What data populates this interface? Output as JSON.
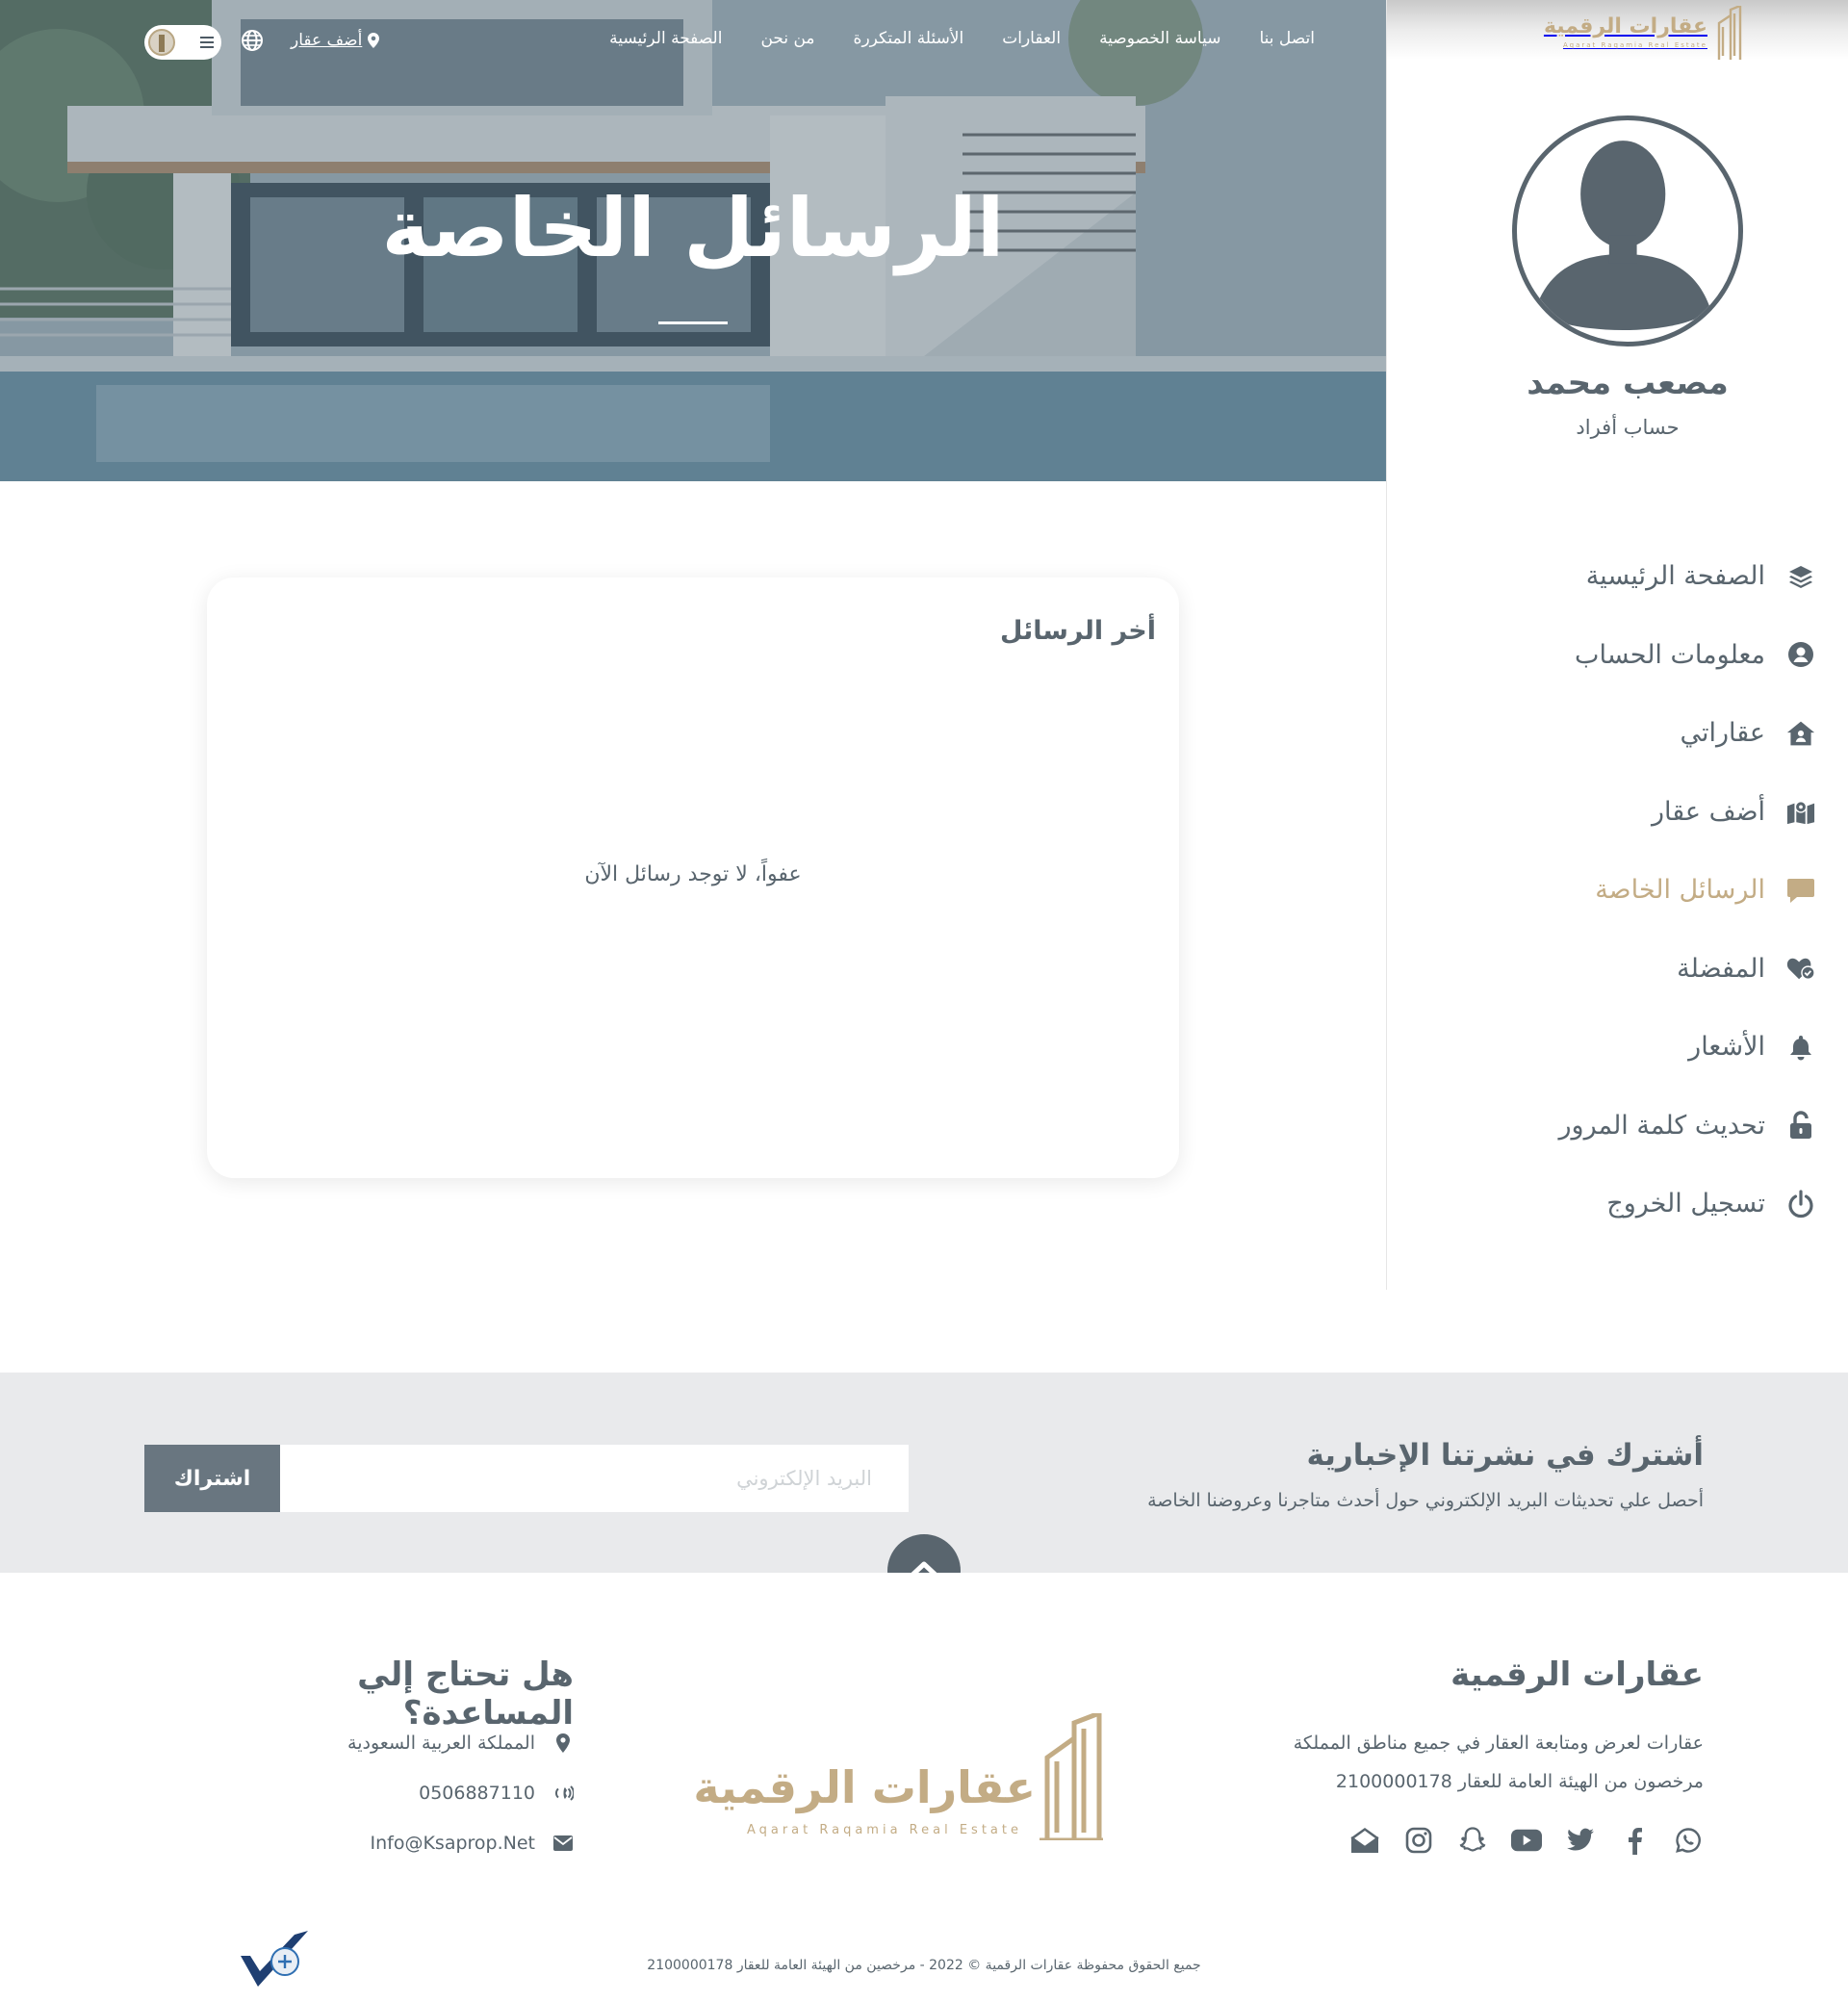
{
  "nav": {
    "links": [
      "الصفحة الرئيسية",
      "من نحن",
      "الأسئلة المتكررة",
      "العقارات",
      "سياسة الخصوصية",
      "اتصل بنا"
    ],
    "add_property": "أضف عقار"
  },
  "hero": {
    "title": "الرسائل الخاصة"
  },
  "brand": {
    "name": "عقارات الرقمية",
    "tagline": "Aqarat Raqamia Real Estate",
    "accent_color": "#c3ac85",
    "primary_color": "#59656e"
  },
  "profile": {
    "name": "مصعب محمد",
    "account_type": "حساب أفراد"
  },
  "menu": [
    {
      "label": "الصفحة الرئيسية",
      "icon": "layers-icon",
      "active": false
    },
    {
      "label": "معلومات الحساب",
      "icon": "user-circle-icon",
      "active": false
    },
    {
      "label": "عقاراتي",
      "icon": "house-user-icon",
      "active": false
    },
    {
      "label": "أضف عقار",
      "icon": "map-marker-icon",
      "active": false
    },
    {
      "label": "الرسائل الخاصة",
      "icon": "message-icon",
      "active": true
    },
    {
      "label": "المفضلة",
      "icon": "heart-check-icon",
      "active": false
    },
    {
      "label": "الأشعار",
      "icon": "bell-icon",
      "active": false
    },
    {
      "label": "تحديث كلمة المرور",
      "icon": "unlock-icon",
      "active": false
    },
    {
      "label": "تسجيل الخروج",
      "icon": "power-icon",
      "active": false
    }
  ],
  "messages": {
    "title": "أخر الرسائل",
    "empty_text": "عفواً، لا توجد رسائل الآن"
  },
  "newsletter": {
    "title": "أشترك في نشرتنا الإخبارية",
    "subtitle": "أحصل علي تحديثات البريد الإلكتروني حول أحدث متاجرنا وعروضنا الخاصة",
    "email_placeholder": "البريد الإلكتروني",
    "email_value": "",
    "subscribe_label": "اشتراك"
  },
  "footer": {
    "about_title": "عقارات الرقمية",
    "about_line1": "عقارات لعرض ومتابعة العقار في جميع مناطق المملكة",
    "about_line2": "مرخصون من الهيئة العامة للعقار 2100000178",
    "socials": [
      "whatsapp-icon",
      "facebook-icon",
      "twitter-icon",
      "youtube-icon",
      "snapchat-icon",
      "instagram-icon",
      "envelope-open-icon"
    ],
    "help_title": "هل تحتاج إلي المساعدة؟",
    "location": "المملكة العربية السعودية",
    "phone": "0506887110",
    "email": "Info@Ksaprop.Net",
    "copyright": "جميع الحقوق محفوظة عقارات الرقمية © 2022 - مرخصين من الهيئة العامة للعقار 2100000178"
  }
}
